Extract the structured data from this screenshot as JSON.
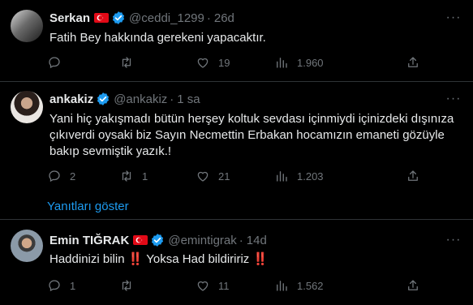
{
  "colors": {
    "background": "#000000",
    "text": "#e7e9ea",
    "muted": "#71767b",
    "accent": "#1d9bf0",
    "divider": "#2f3336",
    "flag": "#e30a17"
  },
  "tweets": [
    {
      "name": "Serkan",
      "flag": true,
      "verified": true,
      "handle": "@ceddi_1299",
      "dot": "·",
      "time": "26d",
      "text": "Fatih Bey hakkında gerekeni yapacaktır.",
      "replies": "",
      "retweets": "",
      "likes": "19",
      "views": "1.960"
    },
    {
      "name": "ankakiz",
      "flag": false,
      "verified": true,
      "handle": "@ankakiz",
      "dot": "·",
      "time": "1 sa",
      "text": "Yani hiç yakışmadı bütün herşey koltuk sevdası içinmiydi içinizdeki dışınıza çıkıverdi oysaki biz Sayın Necmettin Erbakan hocamızın emaneti gözüyle bakıp sevmiştik yazık.!",
      "replies": "2",
      "retweets": "1",
      "likes": "21",
      "views": "1.203"
    },
    {
      "name": "Emin TIĞRAK",
      "flag": true,
      "verified": true,
      "handle": "@emintigrak",
      "dot": "·",
      "time": "14d",
      "text_parts": [
        "Haddinizi bilin ",
        "‼️",
        " Yoksa Had bildiririz ",
        "‼️"
      ],
      "replies": "1",
      "retweets": "",
      "likes": "11",
      "views": "1.562"
    }
  ],
  "show_replies": "Yanıtları göster",
  "icons": {
    "reply": "reply-icon",
    "retweet": "retweet-icon",
    "like": "heart-icon",
    "views": "views-icon",
    "share": "share-icon",
    "more": "more-icon",
    "verified": "verified-badge-icon",
    "flag": "turkey-flag-icon"
  }
}
